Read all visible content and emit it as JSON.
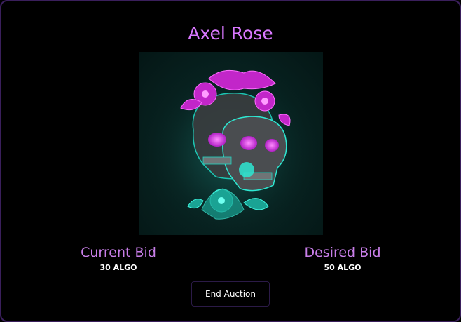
{
  "nft": {
    "title": "Axel Rose",
    "artwork_icon": "neon-skull-artwork"
  },
  "bids": {
    "current_label": "Current Bid",
    "current_value": "30 ALGO",
    "desired_label": "Desired Bid",
    "desired_value": "50 ALGO"
  },
  "actions": {
    "end_auction_label": "End Auction"
  },
  "colors": {
    "accent": "#d978ff",
    "label": "#c87ee8",
    "background": "#000000",
    "artwork_bg": "#082422"
  }
}
